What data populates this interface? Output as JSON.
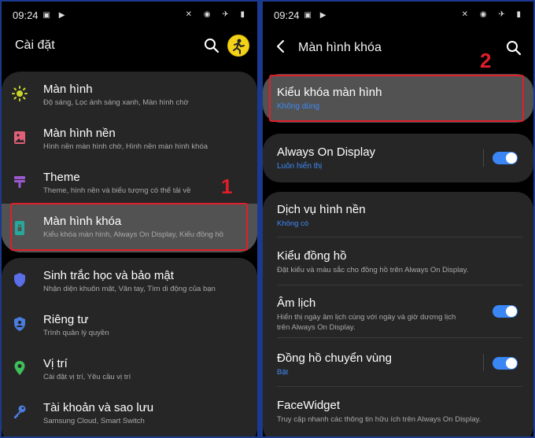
{
  "left_screen": {
    "status": {
      "time": "09:24"
    },
    "title": "Cài đặt",
    "annotation": "1",
    "groups": [
      {
        "items": [
          {
            "title": "Màn hình",
            "subtitle": "Độ sáng, Lọc ánh sáng xanh, Màn hình chờ",
            "icon": "sun-icon",
            "color": "#c9d52b"
          },
          {
            "title": "Màn hình nền",
            "subtitle": "Hình nền màn hình chờ, Hình nền màn hình khóa",
            "icon": "image-icon",
            "color": "#e0607a"
          },
          {
            "title": "Theme",
            "subtitle": "Theme, hình nền và biểu tượng có thể tải về",
            "icon": "paint-brush-icon",
            "color": "#9b59d0"
          },
          {
            "title": "Màn hình khóa",
            "subtitle": "Kiểu khóa màn hình, Always On Display, Kiểu đồng hồ",
            "icon": "lock-screen-icon",
            "color": "#28a89a"
          }
        ]
      },
      {
        "items": [
          {
            "title": "Sinh trắc học và bảo mật",
            "subtitle": "Nhận diện khuôn mặt, Vân tay, Tìm di động của bạn",
            "icon": "shield-icon",
            "color": "#5b6ee8"
          },
          {
            "title": "Riêng tư",
            "subtitle": "Trình quản lý quyền",
            "icon": "privacy-icon",
            "color": "#4a7de0"
          },
          {
            "title": "Vị trí",
            "subtitle": "Cài đặt vị trí, Yêu cầu vị trí",
            "icon": "location-pin-icon",
            "color": "#3fbf5a"
          },
          {
            "title": "Tài khoản và sao lưu",
            "subtitle": "Samsung Cloud, Smart Switch",
            "icon": "key-icon",
            "color": "#4a7de0"
          }
        ]
      }
    ]
  },
  "right_screen": {
    "status": {
      "time": "09:24"
    },
    "title": "Màn hình khóa",
    "annotation": "2",
    "lock_type": {
      "title": "Kiểu khóa màn hình",
      "subtitle": "Không dùng"
    },
    "aod": {
      "title": "Always On Display",
      "subtitle": "Luôn hiển thị",
      "on": true
    },
    "list": [
      {
        "title": "Dịch vụ hình nền",
        "subtitle": "Không có",
        "subtitle_style": "blue",
        "toggle": false
      },
      {
        "title": "Kiểu đồng hồ",
        "subtitle": "Đặt kiểu và màu sắc cho đồng hồ trên Always On Display.",
        "subtitle_style": "gray",
        "toggle": false
      },
      {
        "title": "Âm lịch",
        "subtitle": "Hiển thị ngày âm lịch cùng với ngày và giờ dương lịch",
        "subtitle2": "trên Always On Display.",
        "subtitle_style": "gray",
        "toggle": true
      },
      {
        "title": "Đồng hồ chuyển vùng",
        "subtitle": "Bật",
        "subtitle_style": "blue",
        "toggle": true
      },
      {
        "title": "FaceWidget",
        "subtitle": "Truy cập nhanh các thông tin hữu ích trên Always On Display.",
        "subtitle_style": "gray",
        "toggle": false
      }
    ]
  }
}
